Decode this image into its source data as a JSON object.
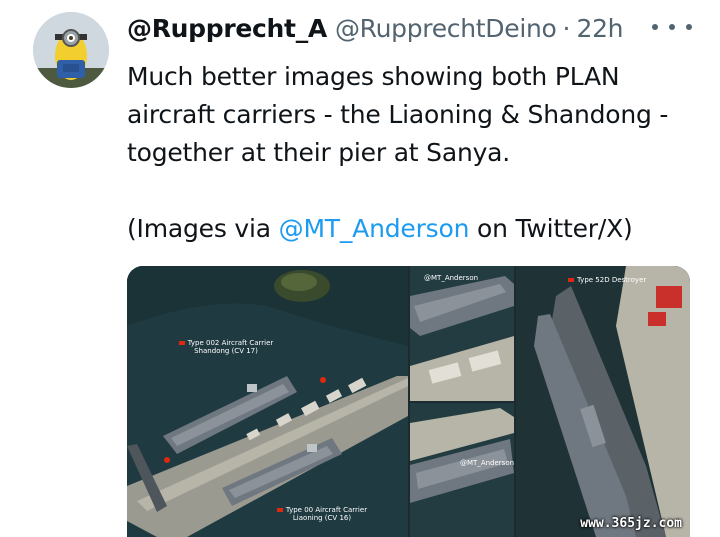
{
  "tweet": {
    "display_name": "@Rupprecht_A",
    "handle": "@RupprechtDeino",
    "separator": "·",
    "timestamp": "22h",
    "text_lines": [
      "Much better images showing both PLAN",
      "aircraft carriers - the Liaoning & Shandong -",
      "together at their pier at Sanya."
    ],
    "credit_prefix": "(Images via ",
    "credit_mention": "@MT_Anderson",
    "credit_suffix": " on Twitter/X)"
  },
  "media": {
    "panel1": {
      "label_shandong_line1": "Type 002 Aircraft Carrier",
      "label_shandong_line2": "Shandong (CV 17)",
      "label_liaoning_line1": "Type 00 Aircraft Carrier",
      "label_liaoning_line2": "Liaoning (CV 16)"
    },
    "panel2": {
      "credit": "@MT_Anderson"
    },
    "panel3": {
      "credit": "@MT_Anderson"
    },
    "panel4": {
      "label_destroyer": "Type 52D Destroyer"
    }
  },
  "watermark": "www.365jz.com",
  "colors": {
    "link": "#1d9bf0",
    "muted": "#536471",
    "text": "#0f1419",
    "flag": "#de2910"
  }
}
